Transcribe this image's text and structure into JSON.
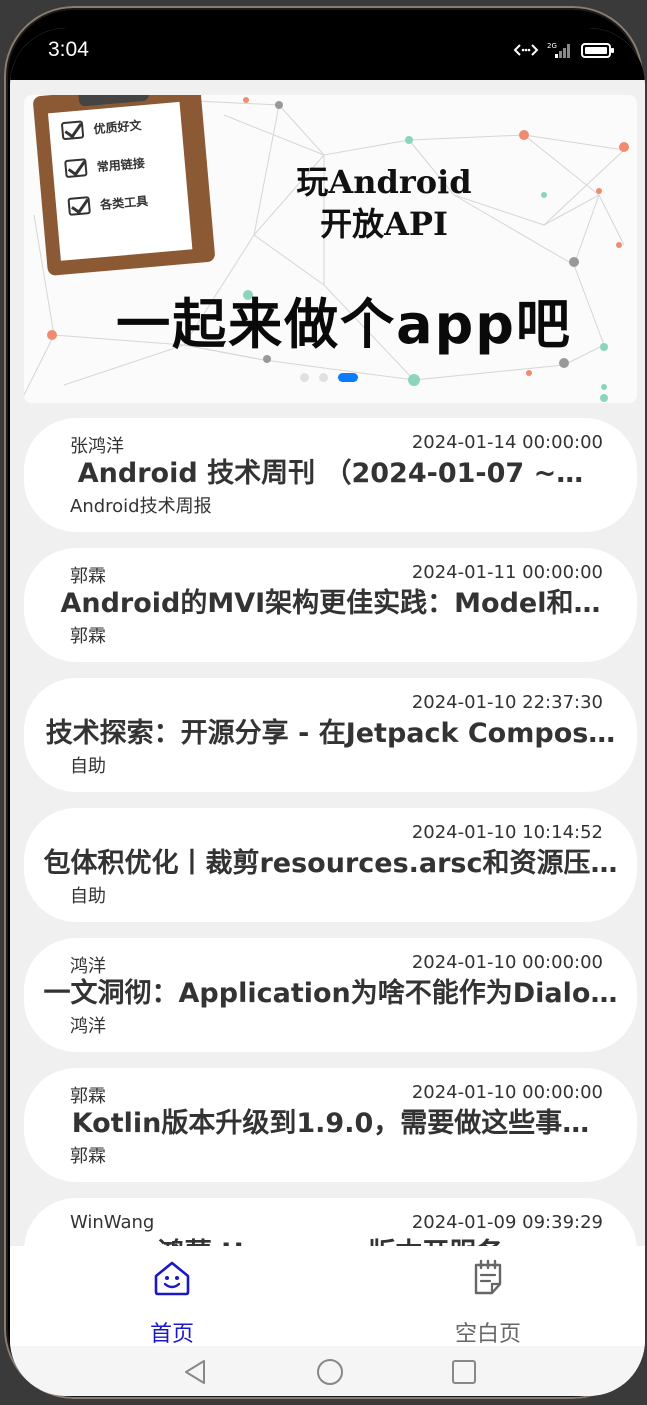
{
  "status_bar": {
    "time": "3:04",
    "network": "2G"
  },
  "banner": {
    "checklist": [
      "优质好文",
      "常用链接",
      "各类工具"
    ],
    "title_line1": "玩Android",
    "title_line2": "开放API",
    "slogan": "一起来做个app吧",
    "slide_count": 3,
    "active_slide": 3
  },
  "articles": [
    {
      "author": "张鸿洋",
      "date": "2024-01-14 00:00:00",
      "title": "Android 技术周刊 （2024-01-07 ~…",
      "chapter": "Android技术周报"
    },
    {
      "author": "郭霖",
      "date": "2024-01-11 00:00:00",
      "title": "Android的MVI架构更佳实践：Model和…",
      "chapter": "郭霖"
    },
    {
      "author": "",
      "date": "2024-01-10 22:37:30",
      "title": "技术探索：开源分享 - 在Jetpack Compos…",
      "chapter": "自助"
    },
    {
      "author": "",
      "date": "2024-01-10 10:14:52",
      "title": "包体积优化丨裁剪resources.arsc和资源压…",
      "chapter": "自助"
    },
    {
      "author": "鸿洋",
      "date": "2024-01-10 00:00:00",
      "title": "一文洞彻：Application为啥不能作为Dialo…",
      "chapter": "鸿洋"
    },
    {
      "author": "郭霖",
      "date": "2024-01-10 00:00:00",
      "title": "Kotlin版本升级到1.9.0，需要做这些事…",
      "chapter": "郭霖"
    },
    {
      "author": "WinWang",
      "date": "2024-01-09 09:39:29",
      "title": "鸿蒙 Harmony 版本开服务",
      "chapter": ""
    }
  ],
  "tabs": [
    {
      "label": "首页",
      "icon": "home-icon",
      "active": true
    },
    {
      "label": "空白页",
      "icon": "notes-icon",
      "active": false
    }
  ],
  "colors": {
    "accent": "#1a18c8",
    "inactive": "#666666",
    "dot_active": "#0a7cff"
  }
}
